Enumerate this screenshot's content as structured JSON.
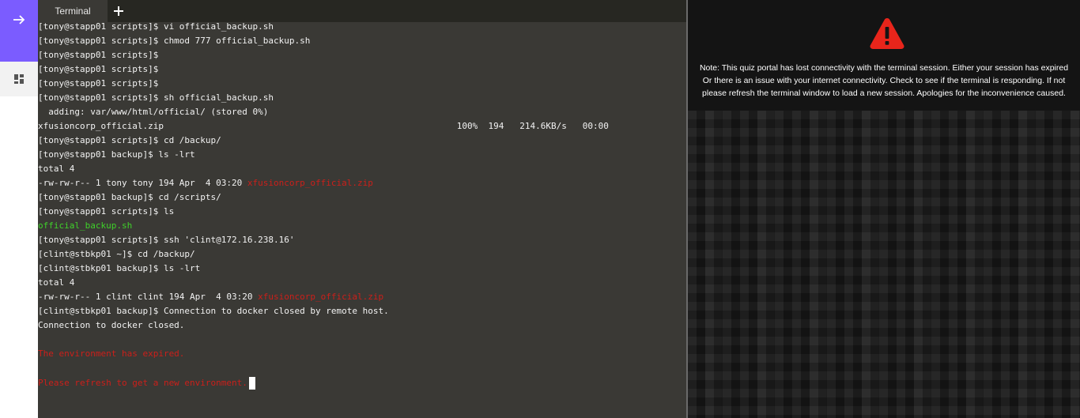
{
  "app": {
    "rail": {
      "expand_icon": "arrow-right-icon",
      "panels_icon": "dashboard-icon",
      "accent_color": "#7b5cff"
    },
    "terminal": {
      "tab_label": "Terminal",
      "add_tab_icon": "plus-icon",
      "lines": {
        "l01": "[tony@stapp01 scripts]$ vi official_backup.sh",
        "l02": "[tony@stapp01 scripts]$ chmod 777 official_backup.sh",
        "l03": "[tony@stapp01 scripts]$",
        "l04": "[tony@stapp01 scripts]$",
        "l05": "[tony@stapp01 scripts]$",
        "l06": "[tony@stapp01 scripts]$ sh official_backup.sh",
        "l07": "  adding: var/www/html/official/ (stored 0%)",
        "l08": "xfusioncorp_official.zip                                                        100%  194   214.6KB/s   00:00",
        "l09": "[tony@stapp01 scripts]$ cd /backup/",
        "l10": "[tony@stapp01 backup]$ ls -lrt",
        "l11": "total 4",
        "l12_prefix": "-rw-rw-r-- 1 tony tony 194 Apr  4 03:20 ",
        "l12_file": "xfusioncorp_official.zip",
        "l13": "[tony@stapp01 backup]$ cd /scripts/",
        "l14": "[tony@stapp01 scripts]$ ls",
        "l15": "official_backup.sh",
        "l16": "[tony@stapp01 scripts]$ ssh 'clint@172.16.238.16'",
        "l17": "[clint@stbkp01 ~]$ cd /backup/",
        "l18": "[clint@stbkp01 backup]$ ls -lrt",
        "l19": "total 4",
        "l20_prefix": "-rw-rw-r-- 1 clint clint 194 Apr  4 03:20 ",
        "l20_file": "xfusioncorp_official.zip",
        "l21": "[clint@stbkp01 backup]$ Connection to docker closed by remote host.",
        "l22": "Connection to docker closed.",
        "l23": "",
        "l24": "The environment has expired.",
        "l25": "",
        "l26": "Please refresh to get a new environment."
      },
      "colors": {
        "error": "#cc1f1a",
        "file_exec": "#3fd12a",
        "background": "#3a3935"
      }
    },
    "notice": {
      "icon": "warning-triangle-icon",
      "icon_color": "#e8251b",
      "line1": "Note: This quiz portal has lost connectivity with the terminal session. Either your session has expired",
      "line2": "Or there is an issue with your internet connectivity. Check to see if the terminal is responding. If not",
      "line3": "please refresh the terminal window to load a new session. Apologies for the inconvenience caused."
    }
  }
}
